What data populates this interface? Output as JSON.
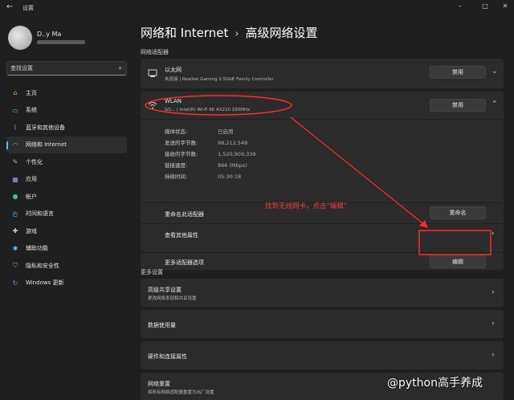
{
  "window": {
    "title": "设置",
    "back_glyph": "←",
    "minimize_glyph": "–",
    "maximize_glyph": "□",
    "close_glyph": "✕"
  },
  "user": {
    "name": "D..y Ma"
  },
  "search": {
    "placeholder": "查找设置",
    "icon": "search-icon"
  },
  "nav": [
    {
      "label": "主页",
      "icon": "home-icon",
      "color": "#f0a050"
    },
    {
      "label": "系统",
      "icon": "monitor-icon",
      "color": "#4cc2ff"
    },
    {
      "label": "蓝牙和其他设备",
      "icon": "bluetooth-icon",
      "color": "#4c9fff"
    },
    {
      "label": "网络和 Internet",
      "icon": "wifi-icon",
      "color": "#5ab0ff"
    },
    {
      "label": "个性化",
      "icon": "brush-icon",
      "color": "#f0a050"
    },
    {
      "label": "应用",
      "icon": "apps-icon",
      "color": "#8fb0d8"
    },
    {
      "label": "帐户",
      "icon": "person-icon",
      "color": "#40c080"
    },
    {
      "label": "时间和语言",
      "icon": "globe-clock-icon",
      "color": "#4cc2ff"
    },
    {
      "label": "游戏",
      "icon": "gamepad-icon",
      "color": "#cfcfcf"
    },
    {
      "label": "辅助功能",
      "icon": "accessibility-icon",
      "color": "#4cc2ff"
    },
    {
      "label": "隐私和安全性",
      "icon": "shield-icon",
      "color": "#a0a0a0"
    },
    {
      "label": "Windows 更新",
      "icon": "update-icon",
      "color": "#4c9fff"
    }
  ],
  "active_nav_index": 3,
  "accent_color": "#4cc2ff",
  "breadcrumb": {
    "parent": "网络和 Internet",
    "separator": "›",
    "current": "高级网络设置"
  },
  "adapters_section": "网络适配器",
  "ethernet": {
    "title": "以太网",
    "subtitle": "未连接 | Realtek Gaming 2.5GbE Family Controller",
    "button": "禁用",
    "icon": "ethernet-icon",
    "chevron": "⌄"
  },
  "wlan": {
    "title": "WLAN",
    "subtitle": "GS... | Intel(R) Wi-Fi 6E AX210 160MHz",
    "button": "禁用",
    "icon": "wifi-icon",
    "chevron": "⌃",
    "details": [
      {
        "key": "媒体状态:",
        "value": "已启用"
      },
      {
        "key": "发送的字节数:",
        "value": "98,212,548"
      },
      {
        "key": "接收的字节数:",
        "value": "1,520,909,339"
      },
      {
        "key": "链接速度:",
        "value": "866 (Mbps)"
      },
      {
        "key": "持续时间:",
        "value": "05:30:18"
      }
    ],
    "rename_label": "重命名此适配器",
    "rename_button": "重命名",
    "view_props_label": "查看其他属性",
    "more_options_label": "更多适配器选项",
    "edit_button": "编辑",
    "row_chevron": "›"
  },
  "annotation": {
    "text": "找到无线网卡，点击“编辑”",
    "color": "#ff3b3b"
  },
  "more_section": "更多设置",
  "more_items": [
    {
      "title": "高级共享设置",
      "subtitle": "更改网络发现和共享设置"
    },
    {
      "title": "数据使用量",
      "subtitle": ""
    },
    {
      "title": "硬件和连接属性",
      "subtitle": ""
    },
    {
      "title": "网络重置",
      "subtitle": "将所有网络适配器重置为出厂设置"
    }
  ],
  "more_chevron": "›",
  "watermark": "@python高手养成"
}
